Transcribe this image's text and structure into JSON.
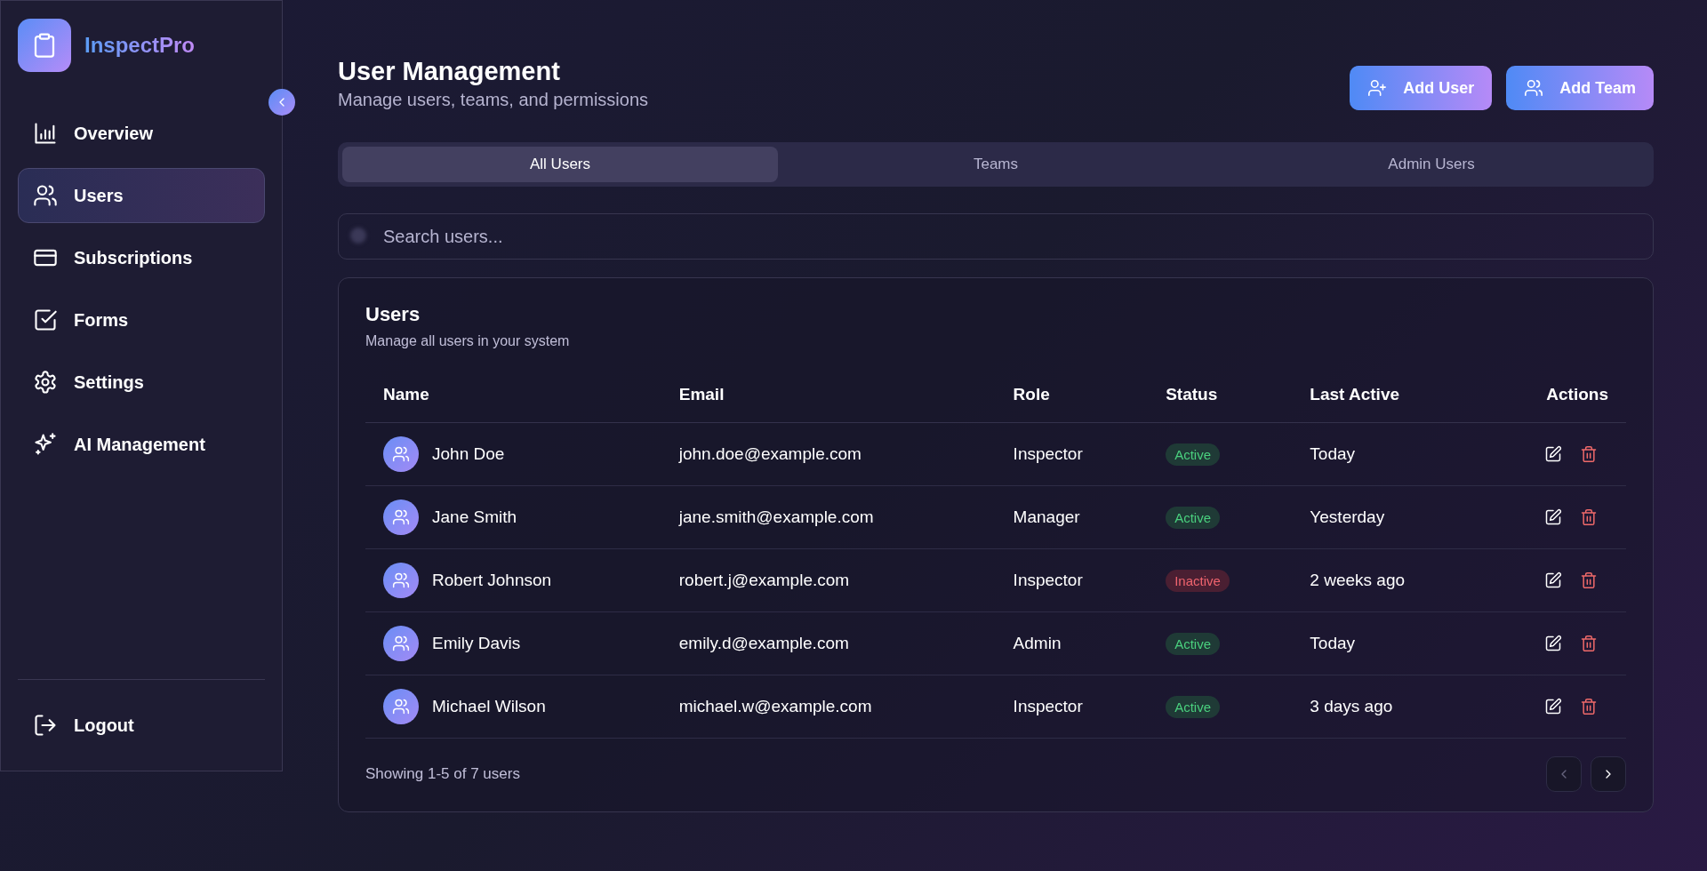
{
  "app": {
    "name": "InspectPro"
  },
  "sidebar": {
    "items": [
      {
        "label": "Overview",
        "selected": false
      },
      {
        "label": "Users",
        "selected": true
      },
      {
        "label": "Subscriptions",
        "selected": false
      },
      {
        "label": "Forms",
        "selected": false
      },
      {
        "label": "Settings",
        "selected": false
      },
      {
        "label": "AI Management",
        "selected": false
      }
    ],
    "logout": "Logout"
  },
  "header": {
    "title": "User Management",
    "subtitle": "Manage users, teams, and permissions",
    "buttons": [
      {
        "label": "Add User"
      },
      {
        "label": "Add Team"
      }
    ]
  },
  "tabs": [
    {
      "label": "All Users",
      "selected": true
    },
    {
      "label": "Teams",
      "selected": false
    },
    {
      "label": "Admin Users",
      "selected": false
    }
  ],
  "search": {
    "placeholder": "Search users..."
  },
  "card": {
    "title": "Users",
    "subtitle": "Manage all users in your system"
  },
  "table": {
    "columns": [
      "Name",
      "Email",
      "Role",
      "Status",
      "Last Active",
      "Actions"
    ],
    "rows": [
      {
        "name": "John Doe",
        "email": "john.doe@example.com",
        "role": "Inspector",
        "status": "Active",
        "active": true,
        "last_active": "Today"
      },
      {
        "name": "Jane Smith",
        "email": "jane.smith@example.com",
        "role": "Manager",
        "status": "Active",
        "active": true,
        "last_active": "Yesterday"
      },
      {
        "name": "Robert Johnson",
        "email": "robert.j@example.com",
        "role": "Inspector",
        "status": "Inactive",
        "active": false,
        "last_active": "2 weeks ago"
      },
      {
        "name": "Emily Davis",
        "email": "emily.d@example.com",
        "role": "Admin",
        "status": "Active",
        "active": true,
        "last_active": "Today"
      },
      {
        "name": "Michael Wilson",
        "email": "michael.w@example.com",
        "role": "Inspector",
        "status": "Active",
        "active": true,
        "last_active": "3 days ago"
      }
    ]
  },
  "pagination": {
    "summary": "Showing 1-5 of 7 users",
    "prev_disabled": true,
    "next_disabled": false
  }
}
